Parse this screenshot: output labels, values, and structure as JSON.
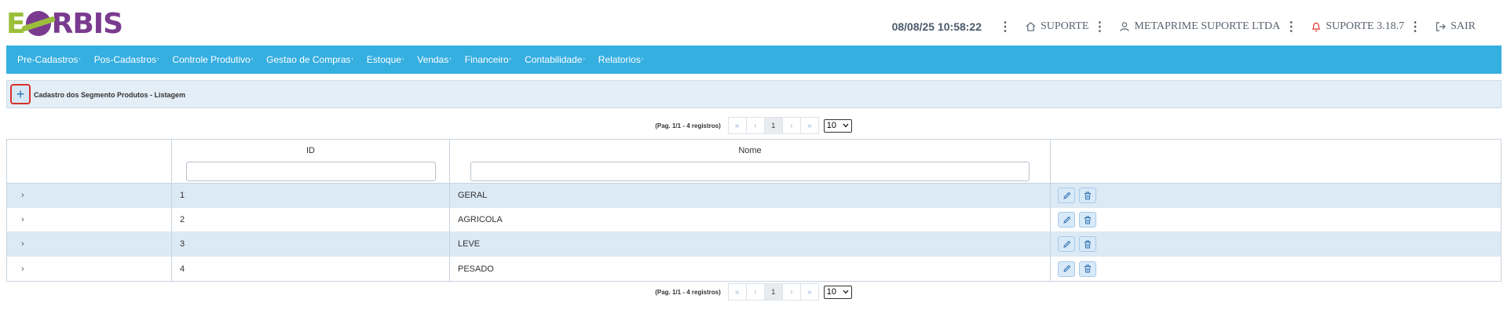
{
  "logo": {
    "text": "EORBIS"
  },
  "header": {
    "datetime": "08/08/25 10:58:22",
    "support_label": "SUPORTE",
    "company_label": "METAPRIME SUPORTE LTDA",
    "version_label": "SUPORTE 3.18.7",
    "exit_label": "SAIR",
    "icons": {
      "support": "home-icon",
      "company": "user-icon",
      "version": "bell-icon",
      "exit": "logout-icon"
    },
    "version_icon_color": "#e0332f"
  },
  "nav": {
    "items": [
      "Pre-Cadastros",
      "Pos-Cadastros",
      "Controle Produtivo",
      "Gestao de Compras",
      "Estoque",
      "Vendas",
      "Financeiro",
      "Contabilidade",
      "Relatorios"
    ],
    "chevron": "›",
    "bg_color": "#35aee0"
  },
  "panel": {
    "add_symbol": "+",
    "title": "Cadastro dos Segmento Produtos - Listagem"
  },
  "pager": {
    "info": "(Pag. 1/1 - 4 registros)",
    "first": "«",
    "prev": "‹",
    "current": "1",
    "next": "›",
    "last": "»",
    "page_size": "10"
  },
  "table": {
    "columns": [
      "ID",
      "Nome"
    ],
    "expander": "›",
    "rows": [
      {
        "id": "1",
        "nome": "GERAL"
      },
      {
        "id": "2",
        "nome": "AGRICOLA"
      },
      {
        "id": "3",
        "nome": "LEVE"
      },
      {
        "id": "4",
        "nome": "PESADO"
      }
    ],
    "row_icons": {
      "edit": "pencil-icon",
      "delete": "trash-icon"
    }
  }
}
